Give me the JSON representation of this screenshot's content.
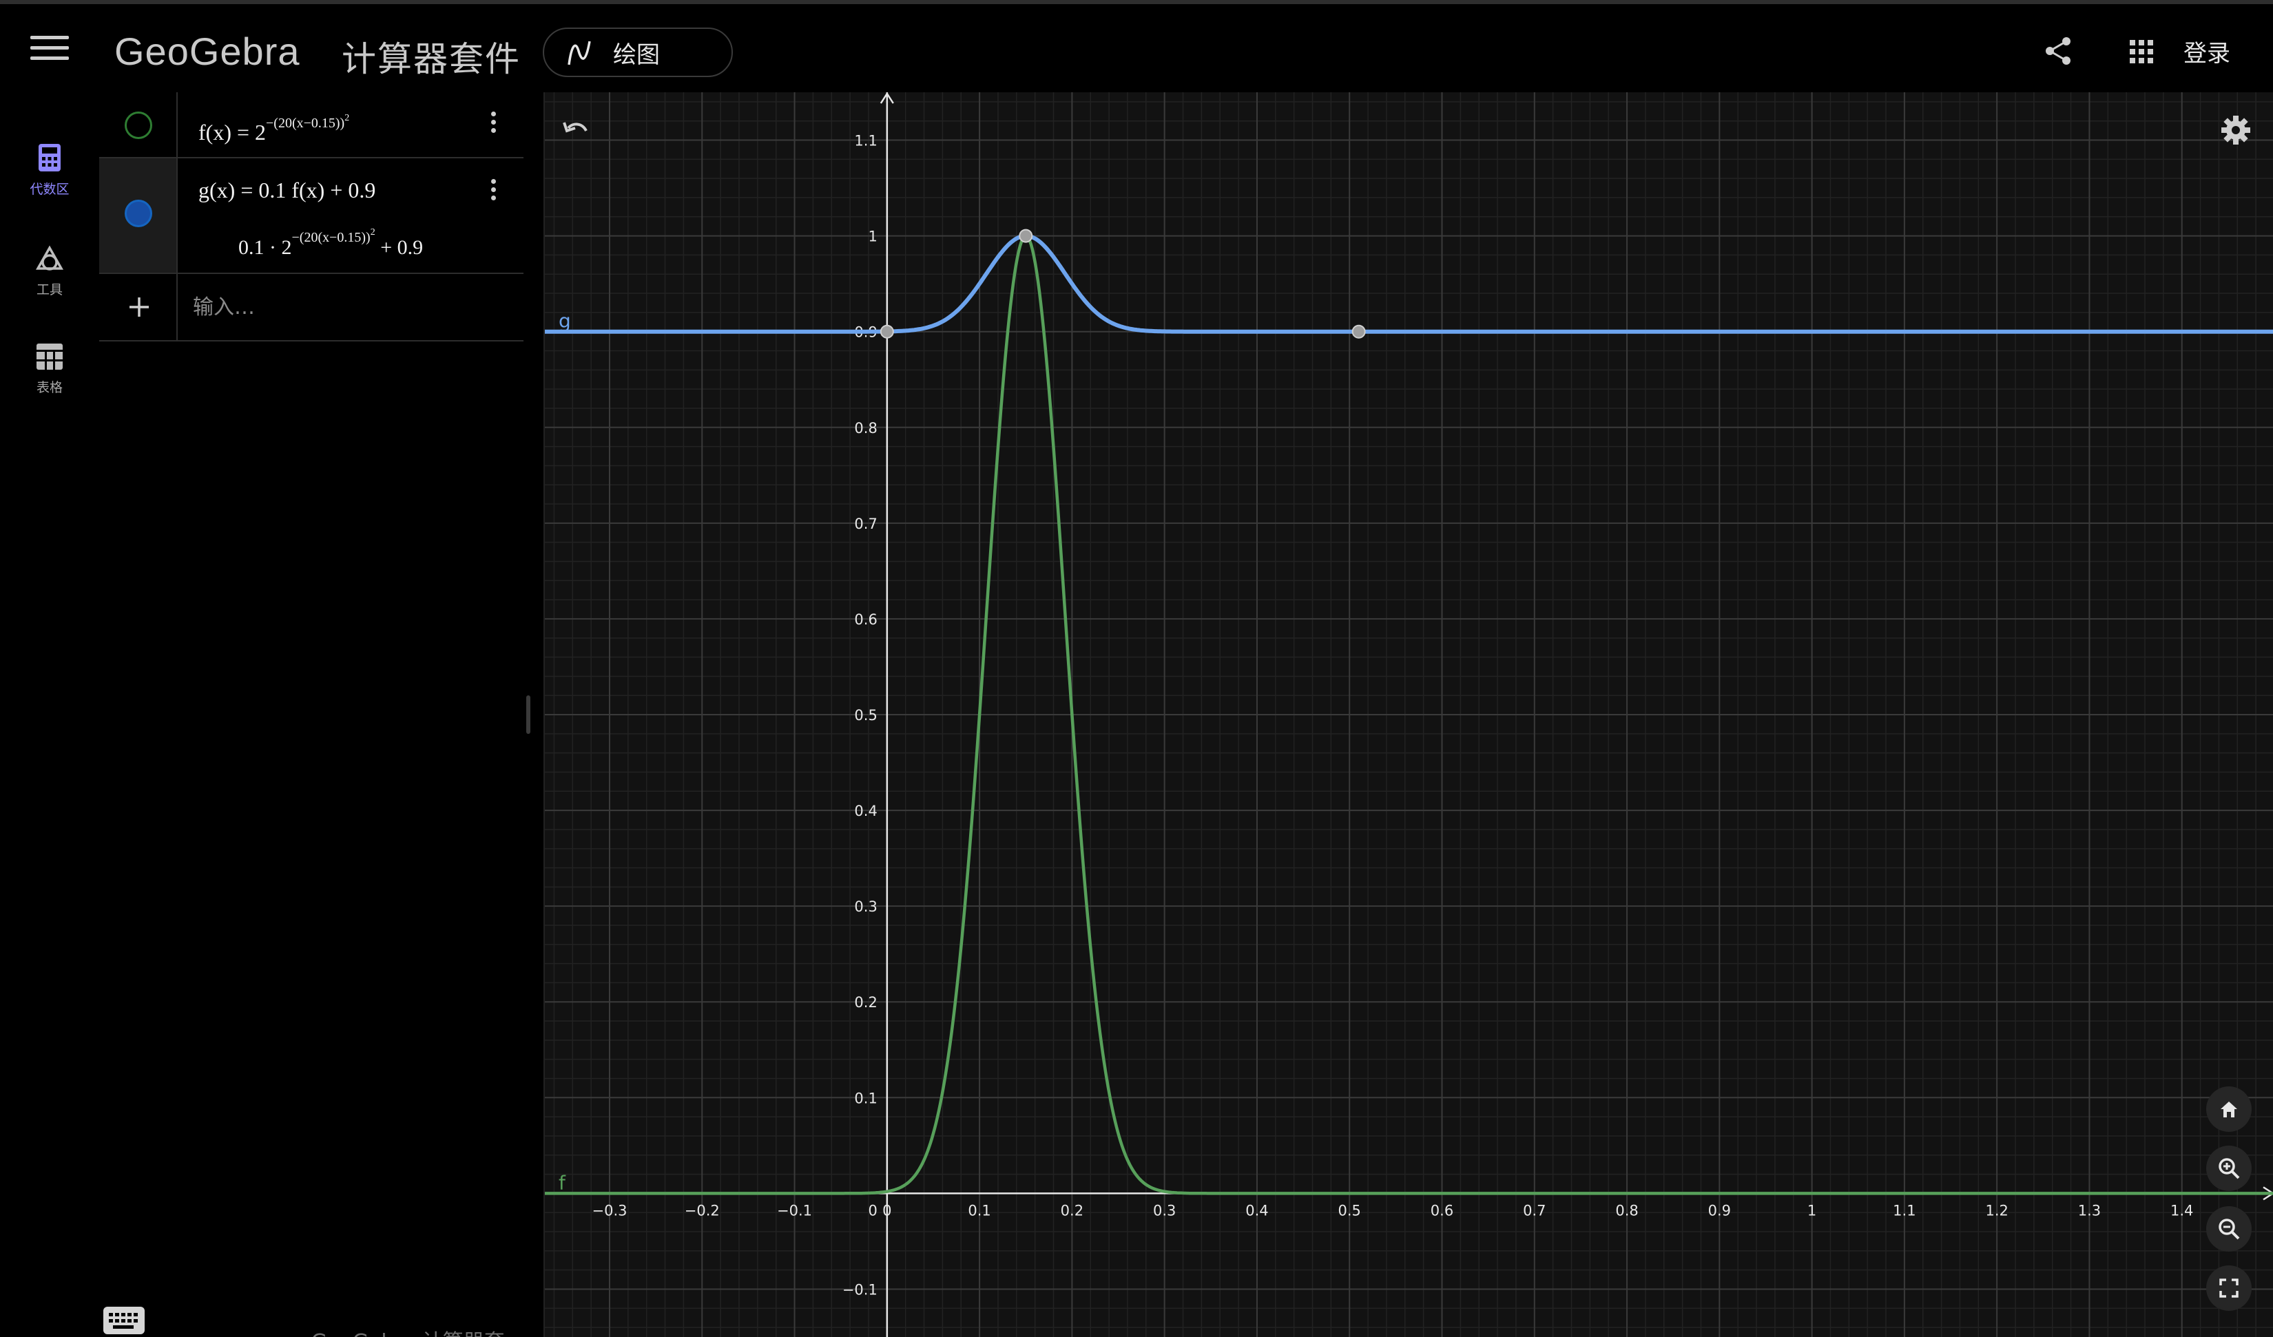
{
  "app": {
    "logo_text": "GeoGebra",
    "suite_name": "计算器套件",
    "app_switch_label": "绘图",
    "login_label": "登录"
  },
  "nav": [
    {
      "label": "代数区",
      "icon": "calculator-icon",
      "active": true
    },
    {
      "label": "工具",
      "icon": "tools-icon",
      "active": false
    },
    {
      "label": "表格",
      "icon": "table-icon",
      "active": false
    }
  ],
  "algebra": {
    "f": {
      "name": "f(x) = 2",
      "exponent": "−(20(x−0.15))",
      "exponent_power": "2",
      "color": "#2e7d32"
    },
    "g": {
      "definition": "g(x) = 0.1 f(x) + 0.9",
      "output_prefix": "0.1 · 2",
      "output_exponent": "−(20(x−0.15))",
      "output_exponent_power": "2",
      "output_suffix": " + 0.9",
      "color": "#1565c0"
    },
    "input_placeholder": "输入…"
  },
  "footer_brand": "GeoGebra 计算器套件",
  "colors": {
    "f_curve": "#57a05a",
    "g_curve": "#6da4ee",
    "accent": "#8f88ff",
    "grid_major": "#3a3a3a",
    "grid_minor": "#222222"
  },
  "chart_data": {
    "type": "line",
    "title": "",
    "xlabel": "",
    "ylabel": "",
    "xlim": [
      -0.37,
      1.5
    ],
    "ylim": [
      -0.15,
      1.15
    ],
    "x_ticks": [
      "-0.3",
      "-0.2",
      "-0.1",
      "0",
      "0.1",
      "0.2",
      "0.3",
      "0.4",
      "0.5",
      "0.6",
      "0.7",
      "0.8",
      "0.9",
      "1",
      "1.1",
      "1.2",
      "1.3",
      "1.4"
    ],
    "y_ticks": [
      "-0.1",
      "0.1",
      "0.2",
      "0.3",
      "0.4",
      "0.5",
      "0.6",
      "0.7",
      "0.8",
      "0.9",
      "1",
      "1.1"
    ],
    "origin_label": "0",
    "grid": true,
    "series": [
      {
        "name": "f",
        "formula": "2^(-(20(x-0.15))^2)",
        "x": [
          -0.3,
          0.0,
          0.05,
          0.1,
          0.125,
          0.15,
          0.175,
          0.2,
          0.25,
          0.3,
          1.4
        ],
        "y": [
          0.0,
          0.0,
          0.0625,
          0.5,
          0.84,
          1.0,
          0.84,
          0.5,
          0.0625,
          0.0,
          0.0
        ]
      },
      {
        "name": "g",
        "formula": "0.1 f(x) + 0.9",
        "x": [
          -0.3,
          0.0,
          0.05,
          0.1,
          0.125,
          0.15,
          0.175,
          0.2,
          0.25,
          0.3,
          1.4
        ],
        "y": [
          0.9,
          0.9,
          0.906,
          0.95,
          0.984,
          1.0,
          0.984,
          0.95,
          0.906,
          0.9,
          0.9
        ]
      }
    ],
    "points": [
      {
        "x": 0.0,
        "y": 0.9
      },
      {
        "x": 0.15,
        "y": 1.0
      },
      {
        "x": 0.51,
        "y": 0.9
      }
    ]
  }
}
